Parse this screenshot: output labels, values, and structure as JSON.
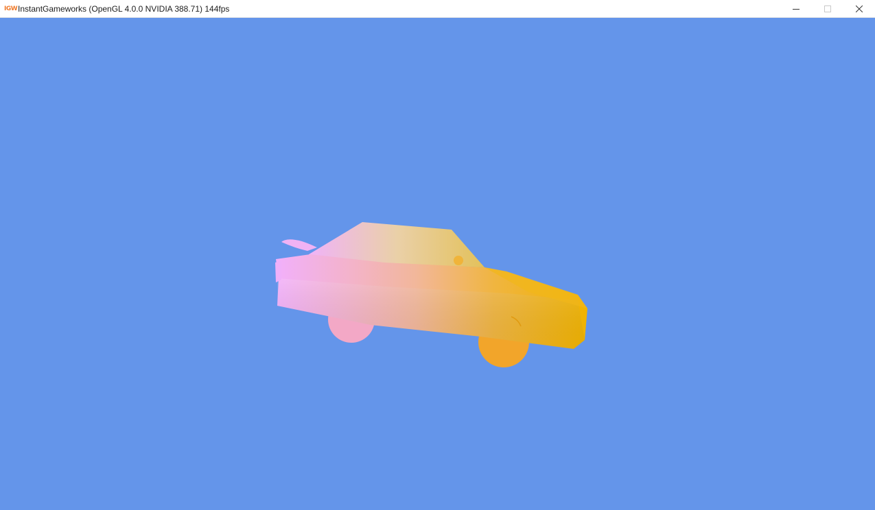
{
  "window": {
    "app_icon_text": "IGW",
    "title": "InstantGameworks (OpenGL 4.0.0 NVIDIA 388.71) 144fps",
    "controls": {
      "minimize_icon": "minimize-icon",
      "maximize_icon": "maximize-icon",
      "close_icon": "close-icon"
    }
  },
  "scene": {
    "background_color": "#6495ea",
    "object": "car-model",
    "gradient_colors": {
      "rear": "#f2b0f7",
      "middle": "#f1b3a8",
      "front": "#f0b000"
    }
  }
}
